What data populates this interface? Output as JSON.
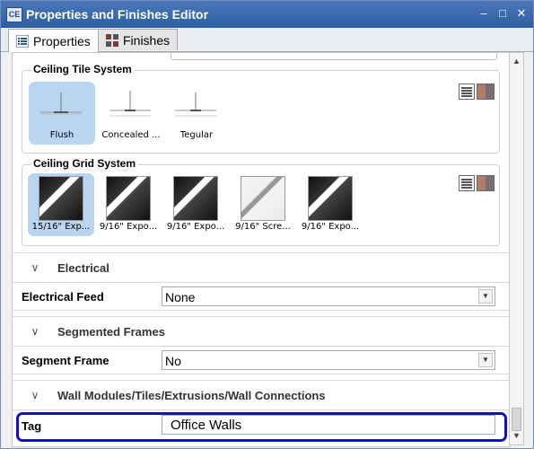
{
  "window": {
    "title": "Properties and Finishes Editor",
    "app_icon": "CE",
    "controls": {
      "minimize": "–",
      "restore": "□",
      "close": "✕"
    }
  },
  "tabs": [
    {
      "label": "Properties",
      "icon": "properties-icon"
    },
    {
      "label": "Finishes",
      "icon": "finishes-icon"
    }
  ],
  "ceiling_tile_system": {
    "title": "Ceiling Tile System",
    "items": [
      {
        "label": "Flush",
        "selected": true
      },
      {
        "label": "Concealed ..."
      },
      {
        "label": "Tegular"
      }
    ]
  },
  "ceiling_grid_system": {
    "title": "Ceiling Grid System",
    "items": [
      {
        "label": "15/16\" Exp...",
        "selected": true
      },
      {
        "label": "9/16\" Expo..."
      },
      {
        "label": "9/16\" Expo..."
      },
      {
        "label": "9/16\" Scre..."
      },
      {
        "label": "9/16\" Expo..."
      }
    ]
  },
  "sections": {
    "electrical": "Electrical",
    "segmented_frames": "Segmented Frames",
    "wall_modules": "Wall Modules/Tiles/Extrusions/Wall Connections"
  },
  "fields": {
    "electrical_feed": {
      "label": "Electrical Feed",
      "value": "None"
    },
    "segment_frame": {
      "label": "Segment Frame",
      "value": "No"
    },
    "tag": {
      "label": "Tag",
      "value": "Office Walls"
    }
  },
  "colors": {
    "selection": "#b9d5ef",
    "highlight_border": "#1010c8"
  }
}
